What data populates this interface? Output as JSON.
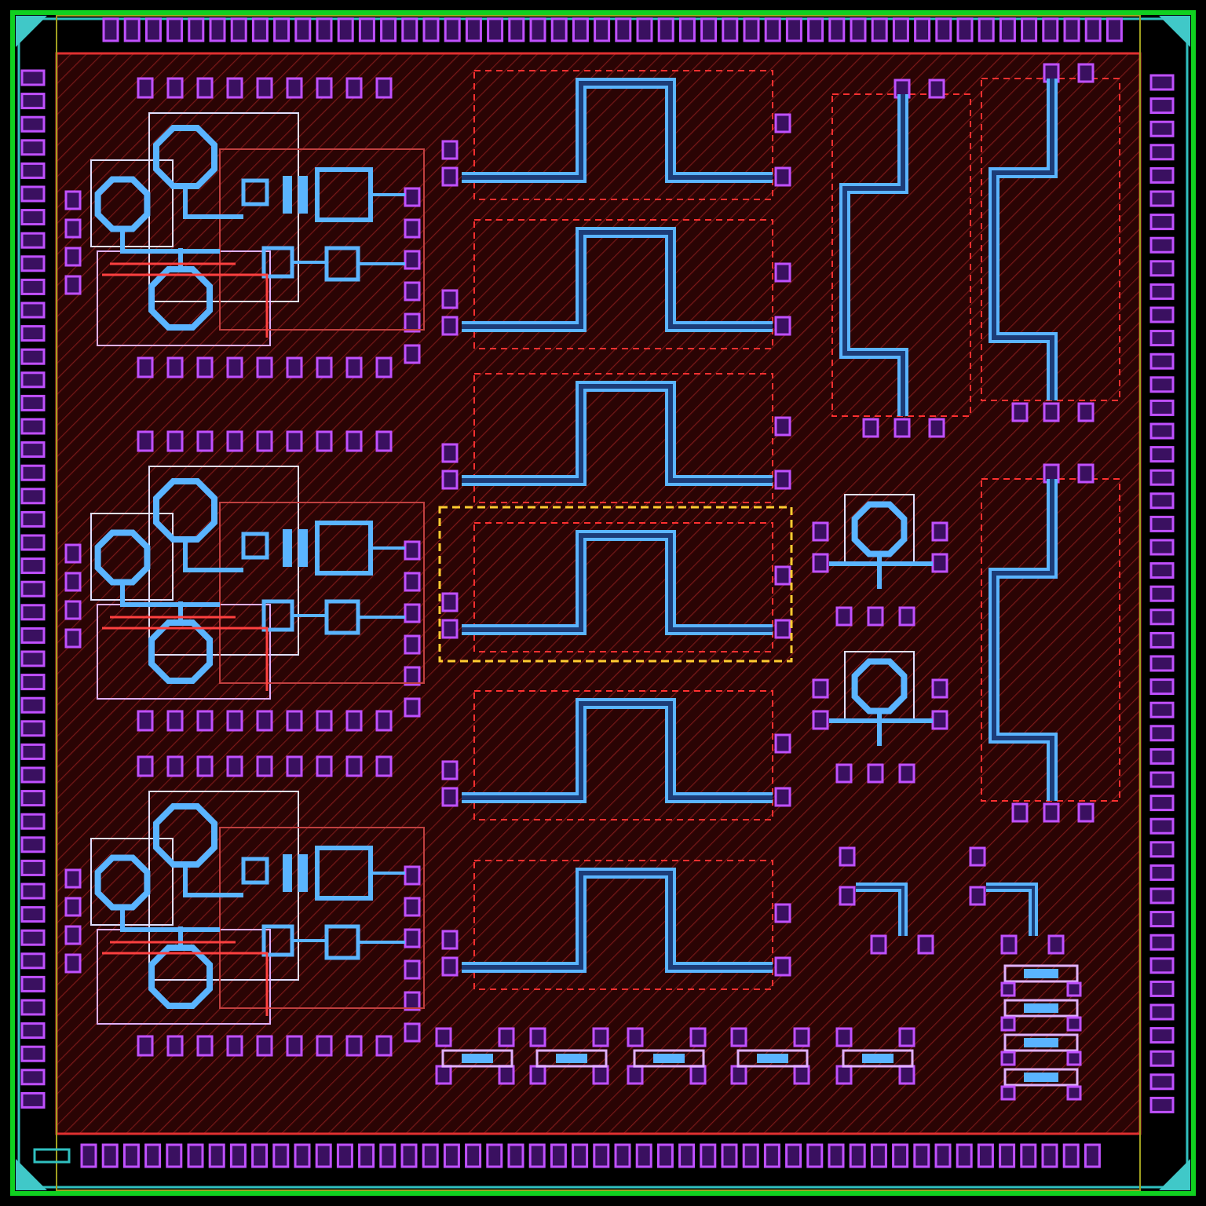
{
  "layout": {
    "pad_ring": {
      "kind": "bond_pads"
    },
    "blocks": [
      {
        "kind": "amplifier",
        "selected": false
      },
      {
        "kind": "amplifier",
        "selected": false
      },
      {
        "kind": "amplifier",
        "selected": false
      },
      {
        "kind": "meander",
        "selected": false
      },
      {
        "kind": "meander",
        "selected": false
      },
      {
        "kind": "meander",
        "selected": false
      },
      {
        "kind": "meander",
        "selected": true
      },
      {
        "kind": "meander",
        "selected": false
      },
      {
        "kind": "meander",
        "selected": false
      },
      {
        "kind": "vertical_meander",
        "selected": false
      },
      {
        "kind": "vertical_meander",
        "selected": false
      },
      {
        "kind": "vertical_meander",
        "selected": false
      },
      {
        "kind": "inductor",
        "selected": false
      },
      {
        "kind": "inductor",
        "selected": false
      },
      {
        "kind": "stub",
        "selected": false
      },
      {
        "kind": "stub",
        "selected": false
      },
      {
        "kind": "resistor",
        "selected": false
      },
      {
        "kind": "resistor",
        "selected": false
      },
      {
        "kind": "resistor",
        "selected": false
      },
      {
        "kind": "resistor",
        "selected": false
      },
      {
        "kind": "resistor",
        "selected": false
      },
      {
        "kind": "resistor_stack",
        "selected": false
      }
    ]
  }
}
